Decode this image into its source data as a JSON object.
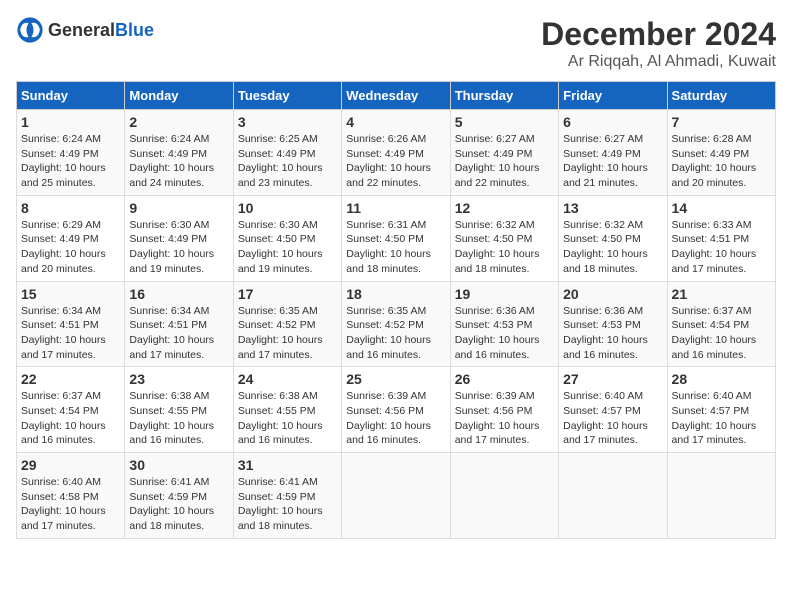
{
  "logo": {
    "general": "General",
    "blue": "Blue"
  },
  "header": {
    "month": "December 2024",
    "location": "Ar Riqqah, Al Ahmadi, Kuwait"
  },
  "weekdays": [
    "Sunday",
    "Monday",
    "Tuesday",
    "Wednesday",
    "Thursday",
    "Friday",
    "Saturday"
  ],
  "weeks": [
    [
      {
        "day": "1",
        "sunrise": "6:24 AM",
        "sunset": "4:49 PM",
        "daylight": "10 hours and 25 minutes."
      },
      {
        "day": "2",
        "sunrise": "6:24 AM",
        "sunset": "4:49 PM",
        "daylight": "10 hours and 24 minutes."
      },
      {
        "day": "3",
        "sunrise": "6:25 AM",
        "sunset": "4:49 PM",
        "daylight": "10 hours and 23 minutes."
      },
      {
        "day": "4",
        "sunrise": "6:26 AM",
        "sunset": "4:49 PM",
        "daylight": "10 hours and 22 minutes."
      },
      {
        "day": "5",
        "sunrise": "6:27 AM",
        "sunset": "4:49 PM",
        "daylight": "10 hours and 22 minutes."
      },
      {
        "day": "6",
        "sunrise": "6:27 AM",
        "sunset": "4:49 PM",
        "daylight": "10 hours and 21 minutes."
      },
      {
        "day": "7",
        "sunrise": "6:28 AM",
        "sunset": "4:49 PM",
        "daylight": "10 hours and 20 minutes."
      }
    ],
    [
      {
        "day": "8",
        "sunrise": "6:29 AM",
        "sunset": "4:49 PM",
        "daylight": "10 hours and 20 minutes."
      },
      {
        "day": "9",
        "sunrise": "6:30 AM",
        "sunset": "4:49 PM",
        "daylight": "10 hours and 19 minutes."
      },
      {
        "day": "10",
        "sunrise": "6:30 AM",
        "sunset": "4:50 PM",
        "daylight": "10 hours and 19 minutes."
      },
      {
        "day": "11",
        "sunrise": "6:31 AM",
        "sunset": "4:50 PM",
        "daylight": "10 hours and 18 minutes."
      },
      {
        "day": "12",
        "sunrise": "6:32 AM",
        "sunset": "4:50 PM",
        "daylight": "10 hours and 18 minutes."
      },
      {
        "day": "13",
        "sunrise": "6:32 AM",
        "sunset": "4:50 PM",
        "daylight": "10 hours and 18 minutes."
      },
      {
        "day": "14",
        "sunrise": "6:33 AM",
        "sunset": "4:51 PM",
        "daylight": "10 hours and 17 minutes."
      }
    ],
    [
      {
        "day": "15",
        "sunrise": "6:34 AM",
        "sunset": "4:51 PM",
        "daylight": "10 hours and 17 minutes."
      },
      {
        "day": "16",
        "sunrise": "6:34 AM",
        "sunset": "4:51 PM",
        "daylight": "10 hours and 17 minutes."
      },
      {
        "day": "17",
        "sunrise": "6:35 AM",
        "sunset": "4:52 PM",
        "daylight": "10 hours and 17 minutes."
      },
      {
        "day": "18",
        "sunrise": "6:35 AM",
        "sunset": "4:52 PM",
        "daylight": "10 hours and 16 minutes."
      },
      {
        "day": "19",
        "sunrise": "6:36 AM",
        "sunset": "4:53 PM",
        "daylight": "10 hours and 16 minutes."
      },
      {
        "day": "20",
        "sunrise": "6:36 AM",
        "sunset": "4:53 PM",
        "daylight": "10 hours and 16 minutes."
      },
      {
        "day": "21",
        "sunrise": "6:37 AM",
        "sunset": "4:54 PM",
        "daylight": "10 hours and 16 minutes."
      }
    ],
    [
      {
        "day": "22",
        "sunrise": "6:37 AM",
        "sunset": "4:54 PM",
        "daylight": "10 hours and 16 minutes."
      },
      {
        "day": "23",
        "sunrise": "6:38 AM",
        "sunset": "4:55 PM",
        "daylight": "10 hours and 16 minutes."
      },
      {
        "day": "24",
        "sunrise": "6:38 AM",
        "sunset": "4:55 PM",
        "daylight": "10 hours and 16 minutes."
      },
      {
        "day": "25",
        "sunrise": "6:39 AM",
        "sunset": "4:56 PM",
        "daylight": "10 hours and 16 minutes."
      },
      {
        "day": "26",
        "sunrise": "6:39 AM",
        "sunset": "4:56 PM",
        "daylight": "10 hours and 17 minutes."
      },
      {
        "day": "27",
        "sunrise": "6:40 AM",
        "sunset": "4:57 PM",
        "daylight": "10 hours and 17 minutes."
      },
      {
        "day": "28",
        "sunrise": "6:40 AM",
        "sunset": "4:57 PM",
        "daylight": "10 hours and 17 minutes."
      }
    ],
    [
      {
        "day": "29",
        "sunrise": "6:40 AM",
        "sunset": "4:58 PM",
        "daylight": "10 hours and 17 minutes."
      },
      {
        "day": "30",
        "sunrise": "6:41 AM",
        "sunset": "4:59 PM",
        "daylight": "10 hours and 18 minutes."
      },
      {
        "day": "31",
        "sunrise": "6:41 AM",
        "sunset": "4:59 PM",
        "daylight": "10 hours and 18 minutes."
      },
      null,
      null,
      null,
      null
    ]
  ],
  "labels": {
    "sunrise_prefix": "Sunrise: ",
    "sunset_prefix": "Sunset: ",
    "daylight_prefix": "Daylight: "
  }
}
